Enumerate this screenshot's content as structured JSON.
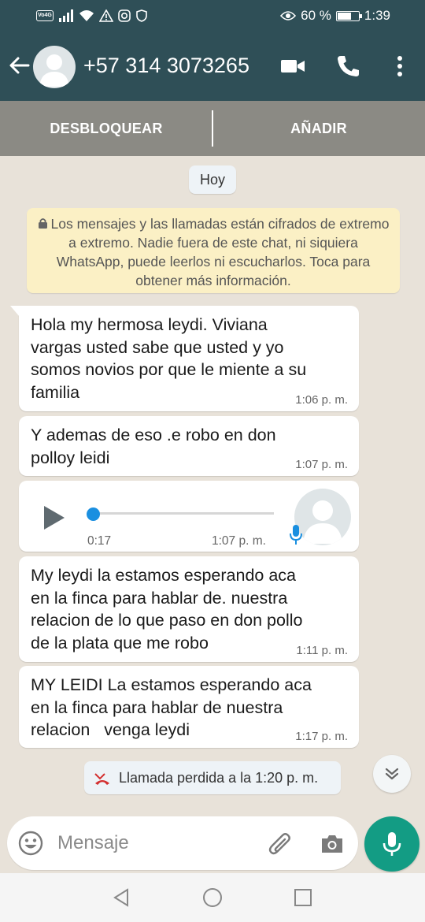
{
  "status_bar": {
    "battery": "60 %",
    "time": "1:39",
    "volte": "Vo4G"
  },
  "header": {
    "contact": "+57 314 3073265"
  },
  "actions": {
    "unblock": "DESBLOQUEAR",
    "add": "AÑADIR"
  },
  "chat": {
    "date": "Hoy",
    "encryption_notice": "Los mensajes y las llamadas están cifrados de extremo a extremo. Nadie fuera de este chat, ni siquiera WhatsApp, puede leerlos ni escucharlos. Toca para obtener más información.",
    "messages": [
      {
        "text": "Hola my hermosa leydi. Viviana\nvargas usted sabe que usted y yo\nsomos novios por que le miente a su\nfamilia",
        "time": "1:06 p. m."
      },
      {
        "text": "Y ademas de eso .e robo en don\npolloy leidi",
        "time": "1:07 p. m."
      },
      {
        "text": "My leydi la estamos esperando aca\nen la finca para hablar de. nuestra\nrelacion de lo que paso en don pollo\nde la plata que me robo",
        "time": "1:11 p. m."
      },
      {
        "text": "MY LEIDI La estamos esperando aca\nen la finca para hablar de nuestra\nrelacion   venga leydi",
        "time": "1:17 p. m."
      }
    ],
    "voice": {
      "duration": "0:17",
      "time": "1:07 p. m.",
      "progress": 0
    },
    "missed_call": "Llamada perdida a la 1:20 p. m."
  },
  "input": {
    "placeholder": "Mensaje"
  },
  "colors": {
    "header": "#2f4f57",
    "accent": "#139c84",
    "missed": "#d32f2f",
    "notice": "#fbf0c5"
  }
}
